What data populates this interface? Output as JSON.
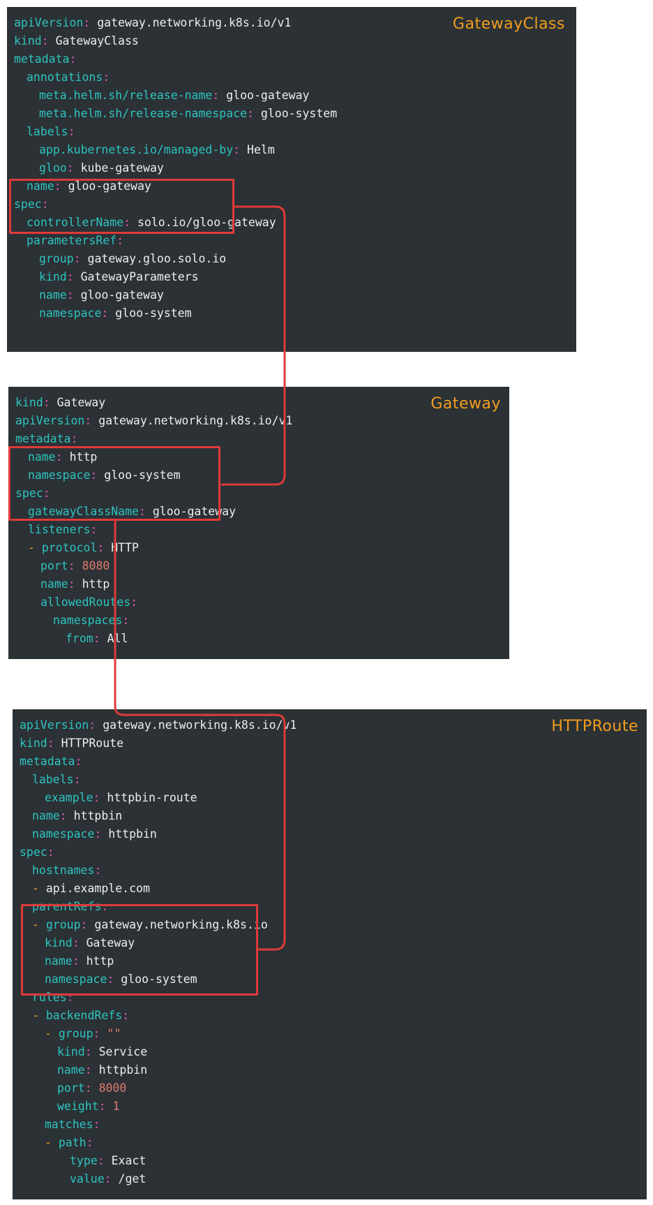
{
  "colors": {
    "panel_bg": "#2b3135",
    "key": "#2ec4c0",
    "punct": "#e05ab0",
    "value": "#eeeeee",
    "number": "#e07a70",
    "dash": "#f29d1d",
    "title": "#f29d1d",
    "highlight": "#e03a3a"
  },
  "panels": [
    {
      "title": "GatewayClass",
      "lines": [
        {
          "i": 0,
          "k": "apiVersion",
          "v": "gateway.networking.k8s.io/v1"
        },
        {
          "i": 0,
          "k": "kind",
          "v": "GatewayClass"
        },
        {
          "i": 0,
          "k": "metadata",
          "v": ""
        },
        {
          "i": 1,
          "k": "annotations",
          "v": ""
        },
        {
          "i": 2,
          "k": "meta.helm.sh/release-name",
          "v": "gloo-gateway"
        },
        {
          "i": 2,
          "k": "meta.helm.sh/release-namespace",
          "v": "gloo-system"
        },
        {
          "i": 1,
          "k": "labels",
          "v": ""
        },
        {
          "i": 2,
          "k": "app.kubernetes.io/managed-by",
          "v": "Helm"
        },
        {
          "i": 2,
          "k": "gloo",
          "v": "kube-gateway"
        },
        {
          "i": 1,
          "k": "name",
          "v": "gloo-gateway"
        },
        {
          "i": 0,
          "k": "spec",
          "v": ""
        },
        {
          "i": 1,
          "k": "controllerName",
          "v": "solo.io/gloo-gateway"
        },
        {
          "i": 1,
          "k": "parametersRef",
          "v": ""
        },
        {
          "i": 2,
          "k": "group",
          "v": "gateway.gloo.solo.io"
        },
        {
          "i": 2,
          "k": "kind",
          "v": "GatewayParameters"
        },
        {
          "i": 2,
          "k": "name",
          "v": "gloo-gateway"
        },
        {
          "i": 2,
          "k": "namespace",
          "v": "gloo-system"
        }
      ]
    },
    {
      "title": "Gateway",
      "lines": [
        {
          "i": 0,
          "k": "kind",
          "v": "Gateway"
        },
        {
          "i": 0,
          "k": "apiVersion",
          "v": "gateway.networking.k8s.io/v1"
        },
        {
          "i": 0,
          "k": "metadata",
          "v": ""
        },
        {
          "i": 1,
          "k": "name",
          "v": "http"
        },
        {
          "i": 1,
          "k": "namespace",
          "v": "gloo-system"
        },
        {
          "i": 0,
          "k": "spec",
          "v": ""
        },
        {
          "i": 1,
          "k": "gatewayClassName",
          "v": "gloo-gateway"
        },
        {
          "i": 1,
          "k": "listeners",
          "v": ""
        },
        {
          "i": 1,
          "dash": true,
          "k": "protocol",
          "v": "HTTP"
        },
        {
          "i": 2,
          "k": "port",
          "v": "8080",
          "num": true
        },
        {
          "i": 2,
          "k": "name",
          "v": "http"
        },
        {
          "i": 2,
          "k": "allowedRoutes",
          "v": ""
        },
        {
          "i": 3,
          "k": "namespaces",
          "v": ""
        },
        {
          "i": 4,
          "k": "from",
          "v": "All"
        }
      ]
    },
    {
      "title": "HTTPRoute",
      "lines": [
        {
          "i": 0,
          "k": "apiVersion",
          "v": "gateway.networking.k8s.io/v1"
        },
        {
          "i": 0,
          "k": "kind",
          "v": "HTTPRoute"
        },
        {
          "i": 0,
          "k": "metadata",
          "v": ""
        },
        {
          "i": 1,
          "k": "labels",
          "v": ""
        },
        {
          "i": 2,
          "k": "example",
          "v": "httpbin-route"
        },
        {
          "i": 1,
          "k": "name",
          "v": "httpbin"
        },
        {
          "i": 1,
          "k": "namespace",
          "v": "httpbin"
        },
        {
          "i": 0,
          "k": "spec",
          "v": ""
        },
        {
          "i": 1,
          "k": "hostnames",
          "v": ""
        },
        {
          "i": 1,
          "dash": true,
          "item": "api.example.com"
        },
        {
          "i": 1,
          "k": "parentRefs",
          "v": ""
        },
        {
          "i": 1,
          "dash": true,
          "k": "group",
          "v": "gateway.networking.k8s.io"
        },
        {
          "i": 2,
          "k": "kind",
          "v": "Gateway"
        },
        {
          "i": 2,
          "k": "name",
          "v": "http"
        },
        {
          "i": 2,
          "k": "namespace",
          "v": "gloo-system"
        },
        {
          "i": 1,
          "k": "rules",
          "v": ""
        },
        {
          "i": 1,
          "dash": true,
          "k": "backendRefs",
          "v": ""
        },
        {
          "i": 2,
          "dash": true,
          "k": "group",
          "v": "\"\"",
          "num": true
        },
        {
          "i": 3,
          "k": "kind",
          "v": "Service"
        },
        {
          "i": 3,
          "k": "name",
          "v": "httpbin"
        },
        {
          "i": 3,
          "k": "port",
          "v": "8000",
          "num": true
        },
        {
          "i": 3,
          "k": "weight",
          "v": "1",
          "num": true
        },
        {
          "i": 2,
          "k": "matches",
          "v": ""
        },
        {
          "i": 2,
          "dash": true,
          "k": "path",
          "v": ""
        },
        {
          "i": 4,
          "k": "type",
          "v": "Exact"
        },
        {
          "i": 4,
          "k": "value",
          "v": "/get"
        }
      ]
    }
  ]
}
